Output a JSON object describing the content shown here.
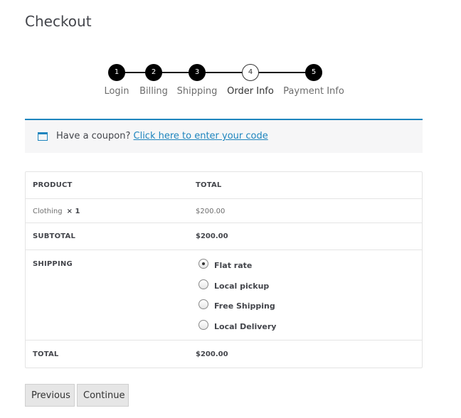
{
  "page": {
    "title": "Checkout"
  },
  "steps": [
    {
      "number": "1",
      "label": "Login",
      "state": "done"
    },
    {
      "number": "2",
      "label": "Billing",
      "state": "done"
    },
    {
      "number": "3",
      "label": "Shipping",
      "state": "done"
    },
    {
      "number": "4",
      "label": "Order Info",
      "state": "current"
    },
    {
      "number": "5",
      "label": "Payment Info",
      "state": "done"
    }
  ],
  "coupon": {
    "icon": "calendar-icon",
    "text": "Have a coupon?",
    "link": "Click here to enter your code",
    "accent": "#1e85be"
  },
  "order": {
    "header": {
      "product": "PRODUCT",
      "total": "TOTAL"
    },
    "item": {
      "name": "Clothing",
      "qty": "× 1",
      "total": "$200.00"
    },
    "subtotal": {
      "label": "SUBTOTAL",
      "value": "$200.00"
    },
    "shipping": {
      "label": "SHIPPING",
      "options": [
        {
          "label": "Flat rate",
          "checked": true
        },
        {
          "label": "Local pickup",
          "checked": false
        },
        {
          "label": "Free Shipping",
          "checked": false
        },
        {
          "label": "Local Delivery",
          "checked": false
        }
      ]
    },
    "total": {
      "label": "TOTAL",
      "value": "$200.00"
    }
  },
  "buttons": {
    "previous": "Previous",
    "continue": "Continue"
  }
}
